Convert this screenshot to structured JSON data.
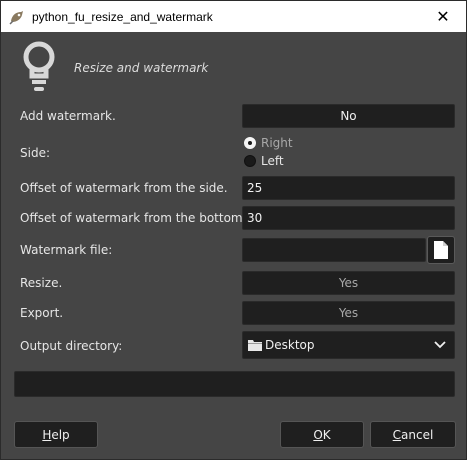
{
  "window": {
    "title": "python_fu_resize_and_watermark",
    "close_glyph": "✕"
  },
  "header": {
    "heading": "Resize and watermark",
    "icon": "lightbulb-icon"
  },
  "form": {
    "add_watermark": {
      "label": "Add watermark.",
      "value": "No"
    },
    "side": {
      "label": "Side:",
      "options": [
        "Right",
        "Left"
      ],
      "selected": "Right"
    },
    "offset_side": {
      "label": "Offset of watermark from the side.",
      "value": "25"
    },
    "offset_bottom": {
      "label": "Offset of watermark from the bottom.",
      "value": "30"
    },
    "watermark_file": {
      "label": "Watermark file:",
      "value": ""
    },
    "resize": {
      "label": "Resize.",
      "value": "Yes"
    },
    "export": {
      "label": "Export.",
      "value": "Yes"
    },
    "output_directory": {
      "label": "Output directory:",
      "value": "Desktop"
    }
  },
  "buttons": {
    "help": {
      "mnemonic": "H",
      "rest": "elp"
    },
    "ok": {
      "mnemonic": "O",
      "rest": "K"
    },
    "cancel": {
      "mnemonic": "C",
      "rest": "ancel"
    }
  },
  "colors": {
    "background": "#454545",
    "field": "#1f1f1f",
    "text": "#e6e6e6",
    "disabled_text": "#a8a8a8"
  }
}
